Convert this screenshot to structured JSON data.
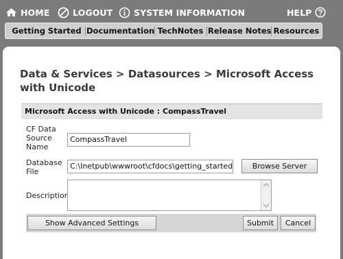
{
  "top_nav": {
    "home": "HOME",
    "logout": "LOGOUT",
    "system_information": "SYSTEM INFORMATION",
    "help": "HELP"
  },
  "sub_nav": {
    "items": [
      "Getting Started",
      "Documentation",
      "TechNotes",
      "Release Notes",
      "Resources"
    ]
  },
  "page": {
    "title": "Data & Services > Datasources > Microsoft Access with Unicode"
  },
  "panel": {
    "header": "Microsoft Access with Unicode :  CompassTravel",
    "fields": {
      "cf_data_source_name": {
        "label": "CF Data Source Name",
        "value": "CompassTravel"
      },
      "database_file": {
        "label": "Database File",
        "value": "C:\\Inetpub\\wwwroot\\cfdocs\\getting_started\\db"
      },
      "description": {
        "label": "Description",
        "value": ""
      }
    },
    "buttons": {
      "browse_server": "Browse Server",
      "show_advanced_settings": "Show Advanced Settings",
      "submit": "Submit",
      "cancel": "Cancel"
    }
  },
  "colors": {
    "background": "#7b7b7b",
    "nav_bar": "#cfcfcf",
    "panel_header": "#e4e4e4",
    "content": "#ffffff"
  }
}
